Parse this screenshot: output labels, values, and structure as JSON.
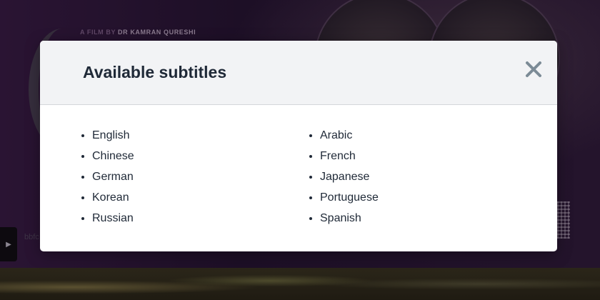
{
  "background": {
    "credit_lead": "A FILM BY",
    "credit_name": "DR KAMRAN QURESHI",
    "ghost_text": "bbfc"
  },
  "modal": {
    "title": "Available subtitles",
    "close_icon": "close-icon",
    "subtitles_left": [
      "English",
      "Chinese",
      "German",
      "Korean",
      "Russian"
    ],
    "subtitles_right": [
      "Arabic",
      "French",
      "Japanese",
      "Portuguese",
      "Spanish"
    ]
  },
  "colors": {
    "header_bg": "#f2f3f5",
    "title_text": "#1f2937",
    "close_icon": "#7c8b96",
    "overlay": "#1d0f26"
  }
}
